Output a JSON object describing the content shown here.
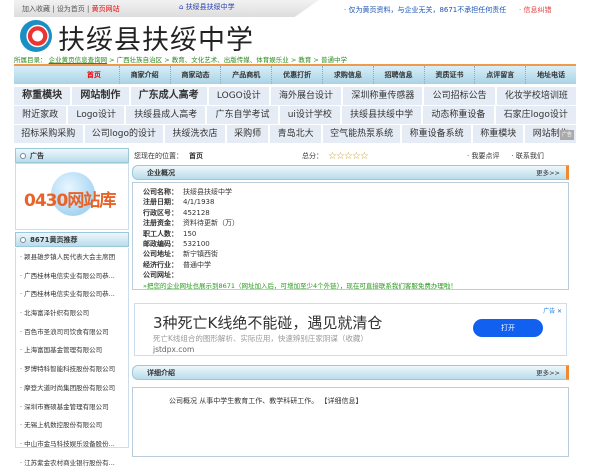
{
  "topbar": {
    "add_fav": "加入收藏",
    "set_home": "设为首页",
    "yellow_site": "黄页网站",
    "site_name": "扶绥县扶绥中学",
    "notice": "· 仅为黄页资料，与企业无关，8671不承担任何责任",
    "report": "· 信息纠错"
  },
  "title": "扶绥县扶绥中学",
  "breadcrumb": {
    "label": "所属目录：",
    "items": [
      "企业黄页信息查询网",
      "广西壮族自治区",
      "教育、文化艺术、出版传媒、体育娱乐业",
      "教育",
      "普通中学"
    ]
  },
  "nav": [
    "首页",
    "商家介绍",
    "商家动态",
    "产品商机",
    "优惠打折",
    "求购信息",
    "招聘信息",
    "资质证书",
    "点评留言",
    "地址电话"
  ],
  "tags": [
    [
      "称重模块",
      "网站制作",
      "广东成人高考",
      "LOGO设计",
      "海外展台设计",
      "深圳称重传感器",
      "公司招标公告",
      "化妆学校培训班"
    ],
    [
      "附近家政",
      "Logo设计",
      "扶绥县成人高考",
      "广东自学考试",
      "ui设计学校",
      "扶绥县扶绥中学",
      "动态称重设备",
      "石家庄logo设计"
    ],
    [
      "招标采购采购",
      "公司logo的设计",
      "扶绥洗衣店",
      "采购师",
      "青岛北大",
      "空气能热泵系统",
      "称重设备系统",
      "称重模块",
      "网站制作"
    ]
  ],
  "scroll_label": "广告",
  "sidebar": {
    "ad_title": "广告",
    "ad_text": "0430网站库",
    "rec_title": "8671黄页推荐",
    "items": [
      "颍县雄步镇人民代表大会主席团",
      "广西桂林电信实业有限公司恭...",
      "广西桂林电信实业有限公司恭...",
      "北海富泽针织有限公司",
      "百色市圣浪司司饮食有限公司",
      "上海富国基金管理有限公司",
      "罗博特科智能科技股份有限公司",
      "摩登大道时尚集团股份有限公司",
      "深圳市赛硕基金管理有限公司",
      "无锡上机数控股份有限公司",
      "中山市金马科技娱乐设备股份...",
      "江苏紫金农村商业银行股份有..."
    ]
  },
  "main": {
    "loc_label": "您现在的位置：",
    "loc_value": "首页",
    "score_label": "总分：",
    "stars": "☆☆☆☆☆",
    "review": "· 我要点评",
    "contact": "· 联系我们",
    "overview_title": "企业概况",
    "more": "更多>>",
    "info": [
      {
        "k": "公司名称：",
        "v": "扶绥县扶绥中学"
      },
      {
        "k": "注册日期：",
        "v": "4/1/1938"
      },
      {
        "k": "行政区号：",
        "v": "452128"
      },
      {
        "k": "注册资金：",
        "v": "资料待更新（万）"
      },
      {
        "k": "职工人数：",
        "v": "150"
      },
      {
        "k": "邮政编码：",
        "v": "532100"
      },
      {
        "k": "公司地址：",
        "v": "新宁镇西街"
      },
      {
        "k": "经济行业：",
        "v": "普通中学"
      },
      {
        "k": "公司网址：",
        "v": ""
      }
    ],
    "promo": "»把您的企业网址也展示到8671（网址加入后，可增加至少4个外链），现在可直接联系我们客服免费办理啦！",
    "ad": {
      "title": "3种死亡K线绝不能碰，遇见就清仓",
      "sub": "死亡K线组合的图形解析、实际应用，快速辨别庄家阴谋（收藏）",
      "url": "jstdpx.com",
      "button": "打开",
      "tag": "广告 ✕"
    },
    "detail_title": "详细介绍",
    "detail_text": "公司概况 从事中学生教育工作、教学科研工作。 【详细信息】"
  }
}
